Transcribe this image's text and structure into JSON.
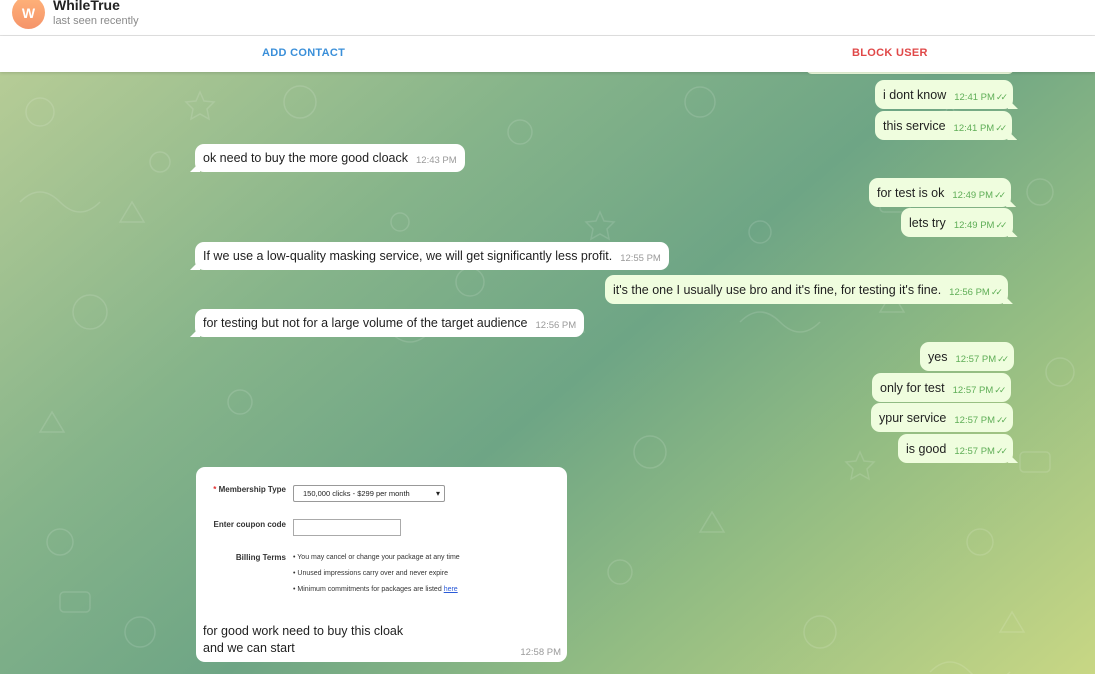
{
  "header": {
    "avatar_letter": "W",
    "title": "WhileTrue",
    "status": "last seen recently"
  },
  "actions": {
    "add_contact": "ADD CONTACT",
    "block_user": "BLOCK USER"
  },
  "colors": {
    "accent_blue": "#3a8fd9",
    "danger_red": "#e04848",
    "outgoing_bubble": "#effdde",
    "incoming_bubble": "#ffffff",
    "time_green": "#5fae57"
  },
  "messages": [
    {
      "dir": "out",
      "text": "i dont know",
      "time": "12:41 PM"
    },
    {
      "dir": "out",
      "text": "this service",
      "time": "12:41 PM"
    },
    {
      "dir": "in",
      "text": "ok need to buy the more  good cloack",
      "time": "12:43 PM"
    },
    {
      "dir": "out",
      "text": "for test is ok",
      "time": "12:49 PM"
    },
    {
      "dir": "out",
      "text": "lets try",
      "time": "12:49 PM"
    },
    {
      "dir": "in",
      "text": "If we use a low-quality masking service, we will get significantly less profit.",
      "time": "12:55 PM"
    },
    {
      "dir": "out",
      "text": "it's the one I usually use bro and it's fine, for testing it's fine.",
      "time": "12:56 PM"
    },
    {
      "dir": "in",
      "text": "for testing but not for a large volume of the target audience",
      "time": "12:56 PM"
    },
    {
      "dir": "out",
      "text": "yes",
      "time": "12:57 PM"
    },
    {
      "dir": "out",
      "text": "only for test",
      "time": "12:57 PM"
    },
    {
      "dir": "out",
      "text": "ypur service",
      "time": "12:57 PM"
    },
    {
      "dir": "out",
      "text": "is good",
      "time": "12:57 PM"
    }
  ],
  "media_message": {
    "form": {
      "membership_label": "Membership Type",
      "membership_value": "150,000 clicks - $299 per month",
      "coupon_label": "Enter coupon code",
      "billing_label": "Billing Terms",
      "terms": [
        "• You may cancel or change your package at any time",
        "• Unused impressions carry over and never expire",
        "• Minimum commitments for packages are listed"
      ],
      "terms_link": "here"
    },
    "caption_line1": "for good work need to buy this cloak",
    "caption_line2": "and we can start",
    "time": "12:58 PM"
  }
}
